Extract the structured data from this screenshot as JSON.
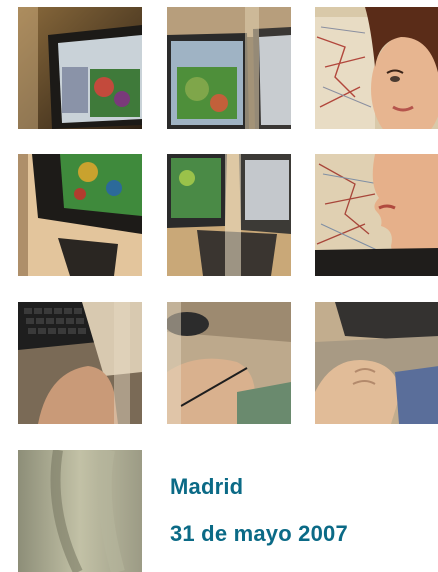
{
  "caption": {
    "place": "Madrid",
    "date": "31 de mayo 2007"
  },
  "colors": {
    "caption_text": "#0b6a86",
    "background": "#ffffff"
  },
  "photos": [
    "monitor-gis-software-photo",
    "monitor-gis-map-photo",
    "woman-viewing-map-photo",
    "monitor-green-map-photo",
    "monitor-stand-photo",
    "woman-face-profile-photo",
    "keyboard-hand-photo",
    "hand-with-stylus-photo",
    "hand-on-tablet-photo",
    "grey-fabric-photo"
  ]
}
